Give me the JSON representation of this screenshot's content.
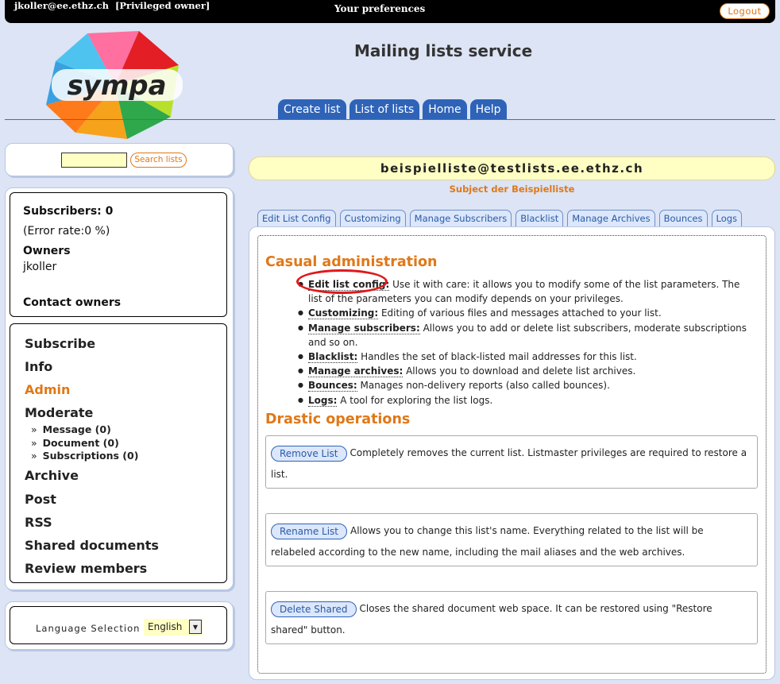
{
  "topbar": {
    "user": "jkoller@ee.ethz.ch",
    "role": "[Privileged owner]",
    "preferences": "Your preferences",
    "logout": "Logout"
  },
  "logo": {
    "text": "sympa"
  },
  "site_title": "Mailing lists service",
  "nav_tabs": [
    "Create list",
    "List of lists",
    "Home",
    "Help"
  ],
  "search": {
    "value": "",
    "button": "Search lists"
  },
  "list_info": {
    "subscribers": "Subscribers: 0",
    "error_rate": "(Error rate:0 %)",
    "owners_label": "Owners",
    "owner": "jkoller",
    "contact": "Contact owners"
  },
  "menu": {
    "items": [
      "Subscribe",
      "Info",
      "Admin",
      "Moderate"
    ],
    "moderate_subs": [
      "Message (0)",
      "Document (0)",
      "Subscriptions (0)"
    ],
    "items_after": [
      "Archive",
      "Post",
      "RSS",
      "Shared documents",
      "Review members"
    ],
    "active": "Admin"
  },
  "language": {
    "label": "Language Selection",
    "selected": "English"
  },
  "list": {
    "address": "beispielliste@testlists.ee.ethz.ch",
    "subject": "Subject der Beispielliste"
  },
  "sub_tabs": [
    "Edit List Config",
    "Customizing",
    "Manage Subscribers",
    "Blacklist",
    "Manage Archives",
    "Bounces",
    "Logs"
  ],
  "casual": {
    "title": "Casual administration",
    "items": [
      {
        "term": "Edit list config:",
        "text": " Use it with care: it allows you to modify some of the list parameters. The list of the parameters you can modify depends on your privileges."
      },
      {
        "term": "Customizing:",
        "text": " Editing of various files and messages attached to your list."
      },
      {
        "term": "Manage subscribers:",
        "text": " Allows you to add or delete list subscribers, moderate subscriptions and so on."
      },
      {
        "term": "Blacklist:",
        "text": " Handles the set of black-listed mail addresses for this list."
      },
      {
        "term": "Manage archives:",
        "text": " Allows you to download and delete list archives."
      },
      {
        "term": "Bounces:",
        "text": " Manages non-delivery reports (also called bounces)."
      },
      {
        "term": "Logs:",
        "text": " A tool for exploring the list logs."
      }
    ]
  },
  "drastic": {
    "title": "Drastic operations",
    "ops": [
      {
        "button": "Remove List",
        "text": "Completely removes the current list. Listmaster privileges are required to restore a list."
      },
      {
        "button": "Rename List",
        "text": "Allows you to change this list's name. Everything related to the list will be relabeled according to the new name, including the mail aliases and the web archives."
      },
      {
        "button": "Delete Shared",
        "text": "Closes the shared document web space. It can be restored using \"Restore shared\" button."
      }
    ]
  },
  "colors": {
    "accent": "#e07818",
    "nav": "#2e63b8",
    "background": "#dce4f5",
    "highlight": "#e0181a"
  }
}
